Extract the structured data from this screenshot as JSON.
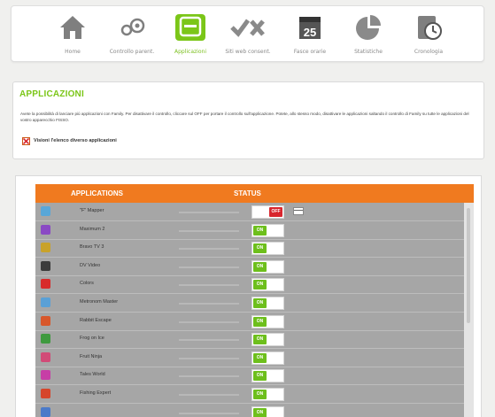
{
  "toolbar": {
    "items": [
      {
        "label": "Home",
        "icon": "home-icon"
      },
      {
        "label": "Controllo parent.",
        "icon": "gears-icon"
      },
      {
        "label": "Applicazioni",
        "icon": "app-icon",
        "active": true
      },
      {
        "label": "Siti web consent.",
        "icon": "check-cross-icon"
      },
      {
        "label": "Fasce orarie",
        "icon": "calendar-icon",
        "text": "25"
      },
      {
        "label": "Statistiche",
        "icon": "pie-chart-icon"
      },
      {
        "label": "Cronologia",
        "icon": "history-icon"
      }
    ]
  },
  "panel": {
    "title": "APPLICAZIONI",
    "text": "Avete la possibilità di lanciare più applicazioni con Family. Per disattivare il controllo, cliccare sul OFF per portare il controllo sull'applicazione. Potete, allo stesso modo, disattivare le applicazioni saltando il controllo di Family su tutte le applicazioni del vostro apparecchio FISSO.",
    "checkbox_label": "Visioni l'elenco diverso applicazioni"
  },
  "table": {
    "header_app": "APPLICATIONS",
    "header_status": "STATUS",
    "rows": [
      {
        "name": "\"F\" Mapper",
        "status": "OFF",
        "icon_color": "#59a7d8"
      },
      {
        "name": "Maximum 2",
        "status": "ON",
        "icon_color": "#8a49c4"
      },
      {
        "name": "Bravo TV 3",
        "status": "ON",
        "icon_color": "#c9a22a"
      },
      {
        "name": "DV Video",
        "status": "ON",
        "icon_color": "#3b3b3b"
      },
      {
        "name": "Colors",
        "status": "ON",
        "icon_color": "#d82b2b"
      },
      {
        "name": "Metronom Master",
        "status": "ON",
        "icon_color": "#5aa0d6"
      },
      {
        "name": "Rabbit Escape",
        "status": "ON",
        "icon_color": "#d8572b"
      },
      {
        "name": "Frog on Ice",
        "status": "ON",
        "icon_color": "#3f9a3f"
      },
      {
        "name": "Fruit Ninja",
        "status": "ON",
        "icon_color": "#d14b77"
      },
      {
        "name": "Tales World",
        "status": "ON",
        "icon_color": "#c73ea6"
      },
      {
        "name": "Fishing Expert",
        "status": "ON",
        "icon_color": "#d6452b"
      },
      {
        "name": "",
        "status": "ON",
        "icon_color": "#4b7ac9"
      }
    ]
  },
  "colors": {
    "accent_green": "#7bc618",
    "header_orange": "#f07a1f",
    "toggle_on": "#6dbf1c",
    "toggle_off": "#d8262e"
  }
}
